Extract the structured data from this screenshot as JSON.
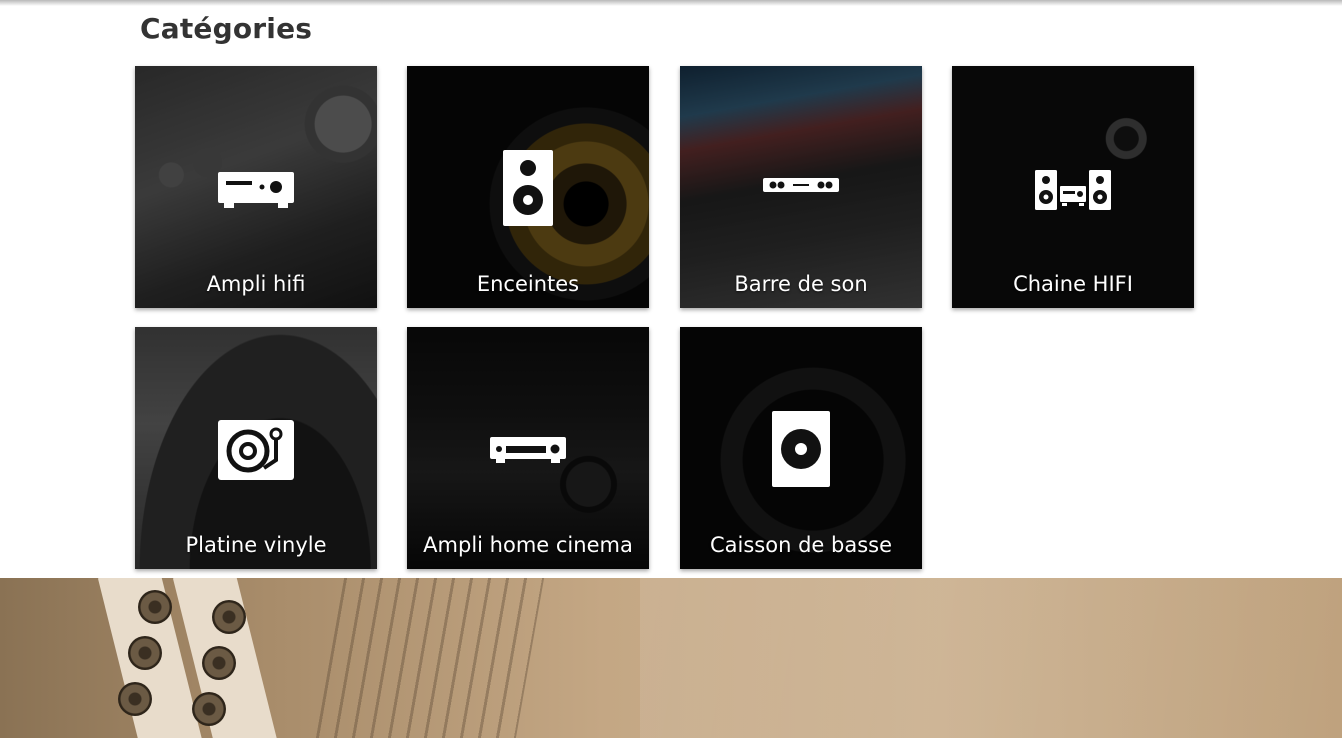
{
  "section": {
    "title": "Catégories"
  },
  "categories": [
    {
      "label": "Ampli hifi",
      "icon": "amplifier-icon"
    },
    {
      "label": "Enceintes",
      "icon": "speaker-icon"
    },
    {
      "label": "Barre de son",
      "icon": "soundbar-icon"
    },
    {
      "label": "Chaine HIFI",
      "icon": "hifi-system-icon"
    },
    {
      "label": "Platine vinyle",
      "icon": "turntable-icon"
    },
    {
      "label": "Ampli home cinema",
      "icon": "av-receiver-icon"
    },
    {
      "label": "Caisson de basse",
      "icon": "subwoofer-icon"
    }
  ],
  "colors": {
    "title": "#333333",
    "tile_label": "#ffffff",
    "banner": "#c4a784"
  }
}
